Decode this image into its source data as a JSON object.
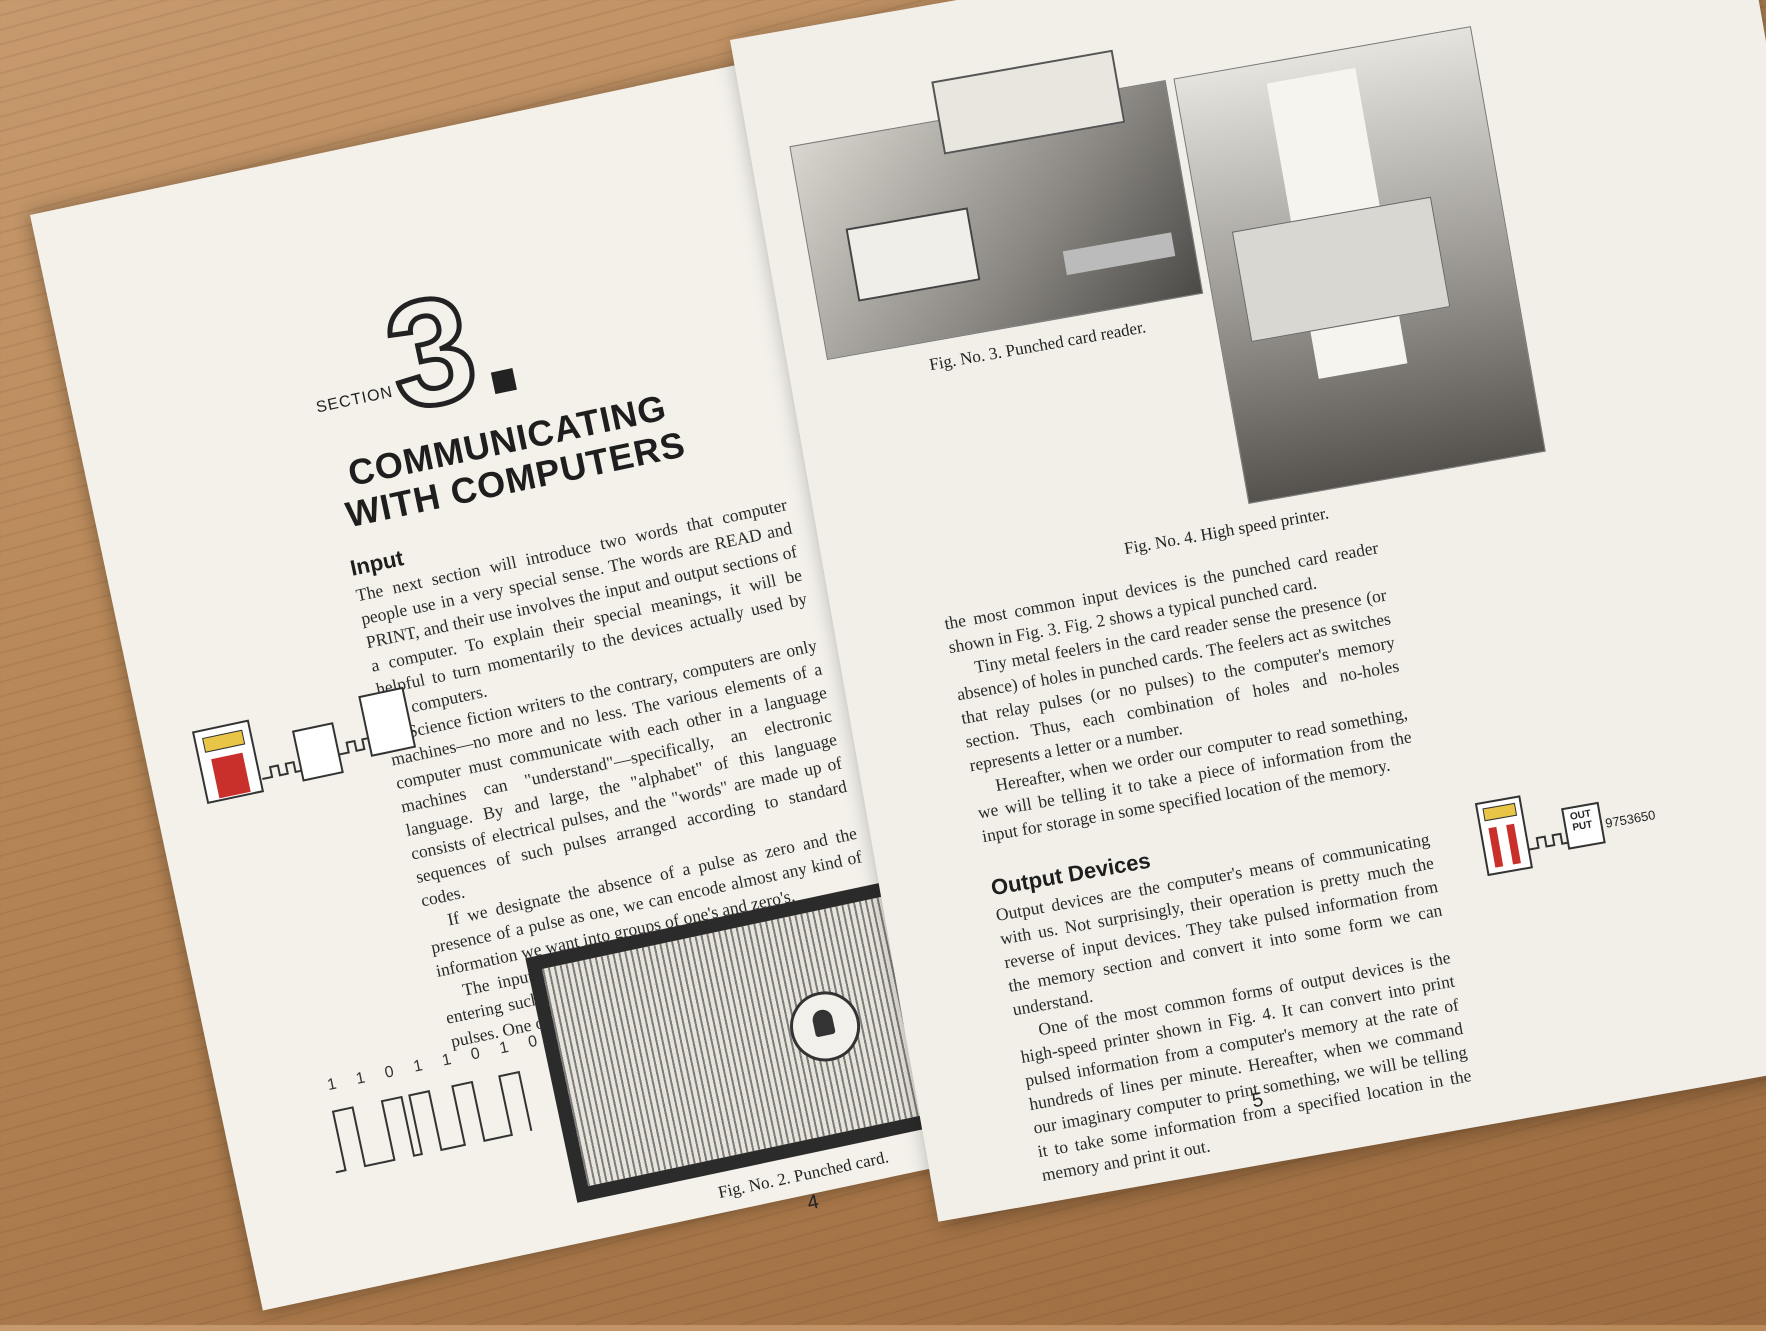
{
  "left_page": {
    "section_word": "SECTION",
    "section_number": "3",
    "title_line1": "COMMUNICATING",
    "title_line2": "WITH COMPUTERS",
    "input_heading": "Input",
    "paragraphs": [
      "The next section will introduce two words that computer people use in a very special sense. The words are READ and PRINT, and their use involves the input and output sections of a computer. To explain their special meanings, it will be helpful to turn momentarily to the devices actually used by real computers.",
      "Science fiction writers to the contrary, computers are only machines—no more and no less. The various elements of a computer must communicate with each other in a language machines can \"understand\"—specifically, an electronic language. By and large, the \"alphabet\" of this language consists of electrical pulses, and the \"words\" are made up of sequences of such pulses arranged according to standard codes.",
      "If we designate the absence of a pulse as zero and the presence of a pulse as one, we can encode almost any kind of information we want into groups of one's and zero's.",
      "The input section of a computer is simply a device for entering such one's and zero's into a computer in the form of pulses. One of"
    ],
    "pulse_bits": "1 1 0 1 1 0 1 0",
    "caption_fig2": "Fig. No. 2. Punched card.",
    "page_number": "4"
  },
  "right_page": {
    "caption_fig3": "Fig. No. 3. Punched card reader.",
    "caption_fig4": "Fig. No. 4. High speed printer.",
    "input_paragraphs": [
      "the most common input devices is the punched card reader shown in Fig. 3. Fig. 2 shows a typical punched card.",
      "Tiny metal feelers in the card reader sense the presence (or absence) of holes in punched cards. The feelers act as switches that relay pulses (or no pulses) to the computer's memory section. Thus, each combination of holes and no-holes represents a letter or a number.",
      "Hereafter, when we order our computer to read something, we will be telling it to take a piece of information from the input for storage in some specified location of the memory."
    ],
    "output_heading": "Output Devices",
    "output_paragraphs": [
      "Output devices are the computer's means of communicating with us. Not surprisingly, their operation is pretty much the reverse of input devices. They take pulsed information from the memory section and convert it into some form we can understand.",
      "One of the most common forms of output devices is the high-speed printer shown in Fig. 4. It can convert into print pulsed information from a computer's memory at the rate of hundreds of lines per minute. Hereafter, when we command our imaginary computer to print something, we will be telling it to take some information from a specified location in the memory and print it out."
    ],
    "output_box_label": "OUT PUT",
    "output_digits": "9753650",
    "page_number": "5"
  }
}
